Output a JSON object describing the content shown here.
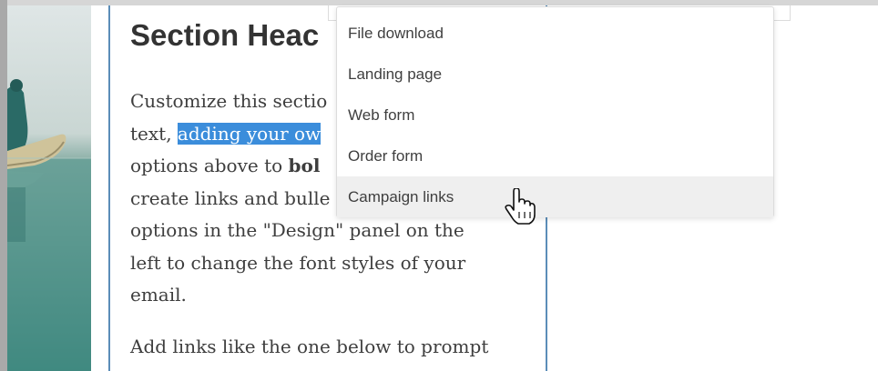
{
  "section": {
    "heading": "Section Heac",
    "paragraph_lines": [
      [
        "Customize this sectio"
      ],
      [
        "text, ",
        "adding your ow"
      ],
      [
        "options above to ",
        "bol"
      ],
      [
        "create links and bulle"
      ],
      [
        "options in the \"Design\" panel on the"
      ],
      [
        "left to change the font styles of your"
      ],
      [
        "email."
      ]
    ],
    "line2_prefix": "text, ",
    "line2_highlight": "adding your ow",
    "line3_prefix": "options above to ",
    "line3_bold": "bol",
    "line1": "Customize this sectio",
    "line4": "create links and bulle",
    "line5": "options in the \"Design\" panel on the",
    "line6": "left to change the font styles of your",
    "line7": "email.",
    "paragraph2": "Add links like the one below to prompt"
  },
  "dropdown": {
    "items": [
      {
        "label": "File download"
      },
      {
        "label": "Landing page"
      },
      {
        "label": "Web form"
      },
      {
        "label": "Order form"
      },
      {
        "label": "Campaign links"
      }
    ],
    "hovered_index": 4
  },
  "colors": {
    "highlight": "#3b8ddb",
    "section_border": "#5b8db8",
    "hover_bg": "#efefef"
  },
  "icons": {
    "cursor": "hand-pointer-icon"
  }
}
